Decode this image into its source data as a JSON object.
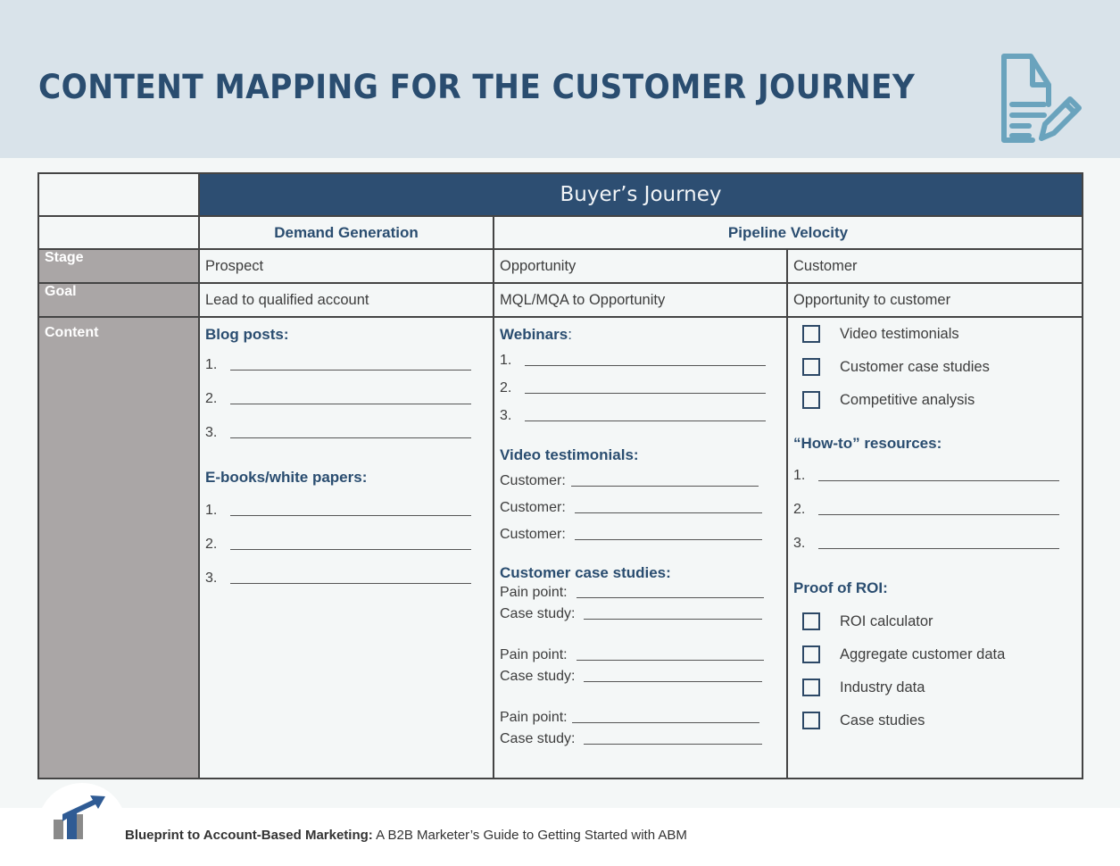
{
  "header": {
    "title": "CONTENT MAPPING FOR THE CUSTOMER JOURNEY",
    "icon": "document-edit-icon",
    "icon_color": "#6aa3bd",
    "background": "#d9e3ea",
    "title_color": "#2a4d70"
  },
  "table": {
    "journey_header": "Buyer’s Journey",
    "journey_header_bg": "#2d4e72",
    "phases": [
      "Demand Generation",
      "Pipeline Velocity"
    ],
    "row_labels": {
      "stage": "Stage",
      "goal": "Goal",
      "content": "Content"
    },
    "row_label_bg": "#aaa6a6",
    "stage": [
      "Prospect",
      "Opportunity",
      "Customer"
    ],
    "goal": [
      "Lead to qualified account",
      "MQL/MQA to Opportunity",
      "Opportunity to customer"
    ],
    "content": {
      "prospect": {
        "blog_posts": {
          "heading": "Blog posts:",
          "items": [
            "1.",
            "2.",
            "3."
          ]
        },
        "ebooks": {
          "heading": "E-books/white papers:",
          "items": [
            "1.",
            "2.",
            "3."
          ]
        }
      },
      "opportunity": {
        "webinars": {
          "heading": "Webinars",
          "heading_suffix": ":",
          "items": [
            "1.",
            "2.",
            "3."
          ]
        },
        "video_testimonials": {
          "heading": "Video testimonials:",
          "items": [
            "Customer:",
            "Customer:",
            "Customer:"
          ]
        },
        "case_studies": {
          "heading": "Customer case studies:",
          "groups": [
            {
              "pain": "Pain point:",
              "case": "Case study:"
            },
            {
              "pain": "Pain point:",
              "case": "Case study:"
            },
            {
              "pain": "Pain point:",
              "case": "Case study:"
            }
          ]
        }
      },
      "customer": {
        "checklist": [
          "Video testimonials",
          "Customer case studies",
          "Competitive analysis"
        ],
        "how_to": {
          "heading": "“How-to” resources:",
          "items": [
            "1.",
            "2.",
            "3."
          ]
        },
        "roi": {
          "heading": "Proof of ROI:",
          "items": [
            "ROI calculator",
            "Aggregate customer data",
            "Industry data",
            "Case studies"
          ]
        }
      }
    }
  },
  "footer": {
    "logo": "rising-bar-chart-arrow-logo",
    "title_bold": "Blueprint to Account-Based Marketing:",
    "subtitle": " A B2B Marketer’s Guide to Getting Started with ABM"
  }
}
